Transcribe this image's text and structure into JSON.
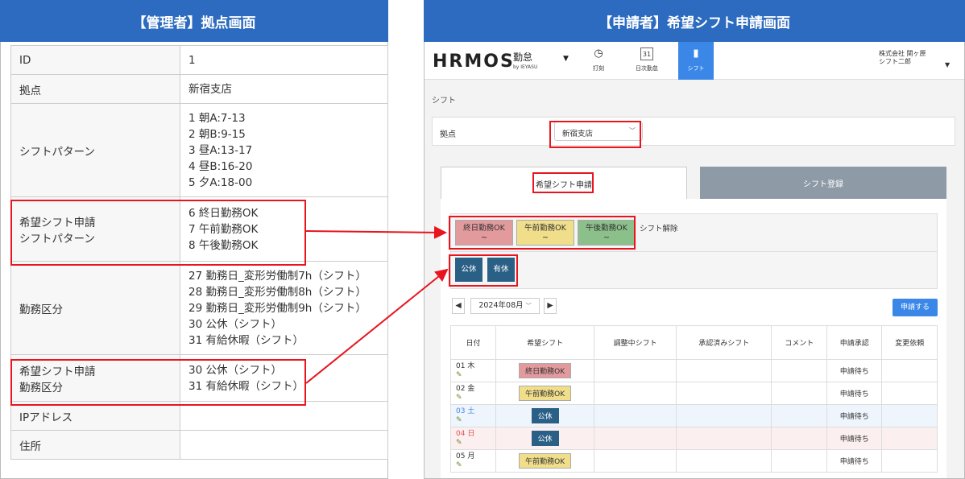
{
  "left": {
    "header": "【管理者】拠点画面",
    "rows": [
      {
        "key": "ID",
        "values": [
          "1"
        ]
      },
      {
        "key": "拠点",
        "values": [
          "新宿支店"
        ]
      },
      {
        "key": "シフトパターン",
        "values": [
          "1 朝A:7-13",
          "2 朝B:9-15",
          "3 昼A:13-17",
          "4 昼B:16-20",
          "5 夕A:18-00"
        ]
      },
      {
        "key": "希望シフト申請\nシフトパターン",
        "values": [
          "6 終日勤務OK",
          "7 午前勤務OK",
          "8 午後勤務OK"
        ]
      },
      {
        "key": "勤務区分",
        "values": [
          "27 勤務日_変形労働制7h（シフト）",
          "28 勤務日_変形労働制8h（シフト）",
          "29 勤務日_変形労働制9h（シフト）",
          "30 公休（シフト）",
          "31 有給休暇（シフト）"
        ]
      },
      {
        "key": "希望シフト申請\n勤務区分",
        "values": [
          "30 公休（シフト）",
          "31 有給休暇（シフト）"
        ]
      },
      {
        "key": "IPアドレス",
        "values": [
          ""
        ]
      },
      {
        "key": "住所",
        "values": [
          ""
        ]
      }
    ]
  },
  "right": {
    "header": "【申請者】希望シフト申請画面",
    "logo": "HRMOS",
    "logo_sub": "勤怠",
    "logo_by": "by IEYASU",
    "nav": [
      {
        "label": "打刻",
        "icon": "clock-icon",
        "glyph": "◷"
      },
      {
        "label": "日次勤怠",
        "icon": "calendar-icon",
        "glyph": "31"
      },
      {
        "label": "シフト",
        "icon": "shift-icon",
        "glyph": "▮"
      }
    ],
    "company": "株式会社 関ヶ原",
    "user": "シフト二郎",
    "breadcrumb": "シフト",
    "location_label": "拠点",
    "location_value": "新宿支店",
    "tab_active": "希望シフト申請",
    "tab_inactive": "シフト登録",
    "patterns": [
      {
        "label": "終日勤務OK",
        "sub": "~",
        "color": "#e39a9d"
      },
      {
        "label": "午前勤務OK",
        "sub": "~",
        "color": "#f0de8a"
      },
      {
        "label": "午後勤務OK",
        "sub": "~",
        "color": "#8cc08a"
      }
    ],
    "clear_label": "シフト解除",
    "holidays": [
      "公休",
      "有休"
    ],
    "holiday_color": "#2a5f86",
    "month": "2024年08月",
    "prev": "◀",
    "next": "▶",
    "apply_label": "申請する",
    "columns": [
      "日付",
      "希望シフト",
      "調整中シフト",
      "承認済みシフト",
      "コメント",
      "申請承認",
      "変更依頼"
    ],
    "rows": [
      {
        "date": "01 木",
        "shift": "終日勤務OK",
        "status": "申請待ち"
      },
      {
        "date": "02 金",
        "shift": "午前勤務OK",
        "status": "申請待ち"
      },
      {
        "date": "03 土",
        "shift": "公休",
        "status": "申請待ち"
      },
      {
        "date": "04 日",
        "shift": "公休",
        "status": "申請待ち"
      },
      {
        "date": "05 月",
        "shift": "午前勤務OK",
        "status": "申請待ち"
      }
    ]
  }
}
